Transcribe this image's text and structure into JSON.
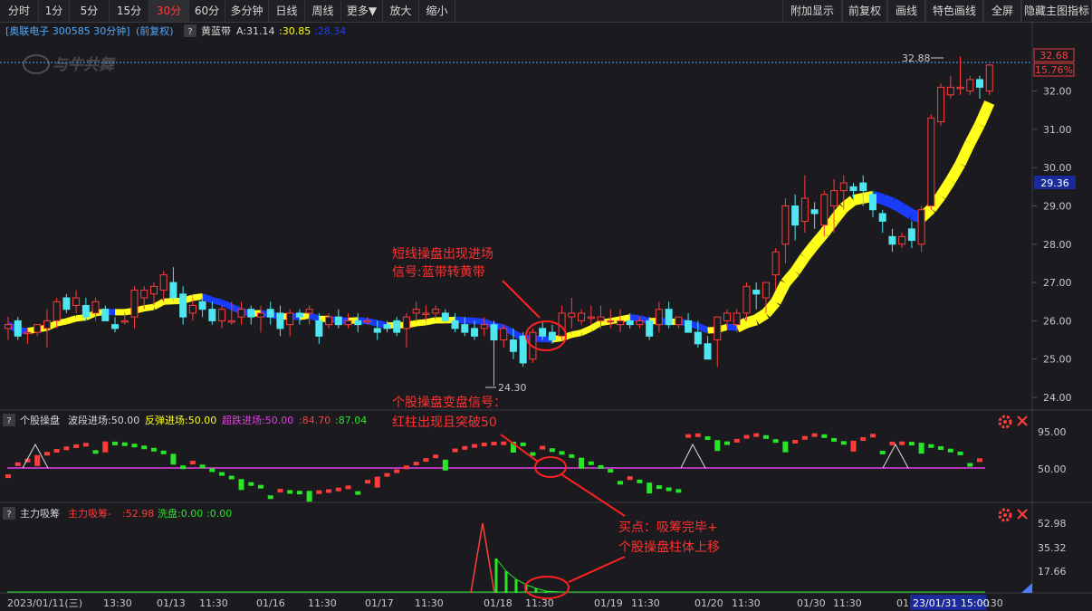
{
  "toolbar": {
    "left": [
      {
        "label": "分时",
        "active": false
      },
      {
        "label": "1分",
        "active": false
      },
      {
        "label": "5分",
        "active": false
      },
      {
        "label": "15分",
        "active": false
      },
      {
        "label": "30分",
        "active": true
      },
      {
        "label": "60分",
        "active": false
      },
      {
        "label": "多分钟",
        "active": false
      },
      {
        "label": "日线",
        "active": false
      },
      {
        "label": "周线",
        "active": false
      },
      {
        "label": "更多▼",
        "active": false
      },
      {
        "label": "放大",
        "active": false
      },
      {
        "label": "缩小",
        "active": false
      }
    ],
    "right": [
      {
        "label": "附加显示"
      },
      {
        "label": "前复权"
      },
      {
        "label": "画线"
      },
      {
        "label": "特色画线"
      },
      {
        "label": "全屏"
      },
      {
        "label": "隐藏主图指标"
      }
    ]
  },
  "main": {
    "stock_label": "[奥联电子 300585 30分钟]",
    "adjust_label": "(前复权)",
    "help_mark": "?",
    "indicator_name": "黄蓝带",
    "ind_a": "A:31.14",
    "ind_b": ":30.85",
    "ind_c": ":28.34",
    "watermark": "与牛共舞",
    "high_label": "32.88",
    "low_label": "24.30",
    "last_price": "32.68",
    "pct_change": "15.76%",
    "band_price": "29.36",
    "y_ticks": [
      "32.00",
      "31.00",
      "30.00",
      "29.00",
      "28.00",
      "27.00",
      "26.00",
      "25.00",
      "24.00"
    ],
    "annotation_line1": "短线操盘出现进场",
    "annotation_line2": "信号:蓝带转黄带"
  },
  "panel1": {
    "help_mark": "?",
    "name": "个股操盘",
    "a": "波段进场:50.00",
    "b": "反弹进场:50.00",
    "c": "超跌进场:50.00",
    "d": ":84.70",
    "e": ":87.04",
    "y_ticks": [
      "95.00",
      "50.00"
    ],
    "annotation_line1": "个股操盘变盘信号：",
    "annotation_line2": "红柱出现且突破50"
  },
  "panel2": {
    "help_mark": "?",
    "name": "主力吸筹",
    "a": "主力吸筹-",
    "b": ":52.98",
    "c": "洗盘:0.00",
    "d": ":0.00",
    "y_ticks": [
      "52.98",
      "35.32",
      "17.66"
    ],
    "annotation_line1": "买点：吸筹完毕+",
    "annotation_line2": "个股操盘柱体上移"
  },
  "xaxis": {
    "labels": [
      "2023/01/11(三)",
      "13:30",
      "01/13",
      "11:30",
      "01/16",
      "11:30",
      "01/17",
      "11:30",
      "01/18",
      "11:30",
      "01/19",
      "11:30",
      "01/20",
      "11:30",
      "01/30",
      "11:30",
      "01"
    ],
    "cursor_label": "23/01/31 15:00",
    "tail_label": ":30"
  },
  "colors": {
    "up": "#ff3c3c",
    "down": "#4fe6f0",
    "yellow": "#ffff1a",
    "blue": "#1a3cff",
    "green": "#27e627",
    "magenta": "#e63ce6",
    "accent_red": "#ff2020"
  },
  "chart_data": {
    "type": "candlestick",
    "candles": [
      [
        25.8,
        26.1,
        25.5,
        25.9
      ],
      [
        26.0,
        26.1,
        25.5,
        25.6
      ],
      [
        25.7,
        25.8,
        25.4,
        25.7
      ],
      [
        25.7,
        25.9,
        25.6,
        25.9
      ],
      [
        25.8,
        26.3,
        25.3,
        26.0
      ],
      [
        26.0,
        26.6,
        25.8,
        26.5
      ],
      [
        26.6,
        26.7,
        26.2,
        26.3
      ],
      [
        26.4,
        26.8,
        26.2,
        26.6
      ],
      [
        26.4,
        26.6,
        26.0,
        26.1
      ],
      [
        26.2,
        26.6,
        26.0,
        26.5
      ],
      [
        26.3,
        26.4,
        26.0,
        26.0
      ],
      [
        25.9,
        26.1,
        25.7,
        25.8
      ],
      [
        26.0,
        26.2,
        25.9,
        26.0
      ],
      [
        26.1,
        26.9,
        25.8,
        26.8
      ],
      [
        26.6,
        26.9,
        26.3,
        26.8
      ],
      [
        26.7,
        27.0,
        26.4,
        26.9
      ],
      [
        26.8,
        27.3,
        26.5,
        27.2
      ],
      [
        27.0,
        27.4,
        26.5,
        26.6
      ],
      [
        26.7,
        26.9,
        25.9,
        26.1
      ],
      [
        26.2,
        26.6,
        26.0,
        26.4
      ],
      [
        26.5,
        26.7,
        26.1,
        26.3
      ],
      [
        26.3,
        26.5,
        25.9,
        26.0
      ],
      [
        26.0,
        26.4,
        25.8,
        26.3
      ],
      [
        26.0,
        26.5,
        25.9,
        26.0
      ],
      [
        26.1,
        26.5,
        25.9,
        26.3
      ],
      [
        26.3,
        26.4,
        25.9,
        26.1
      ],
      [
        26.1,
        26.4,
        25.7,
        26.2
      ],
      [
        26.3,
        26.5,
        25.9,
        26.1
      ],
      [
        26.2,
        26.4,
        25.6,
        25.8
      ],
      [
        25.9,
        26.3,
        25.6,
        26.2
      ],
      [
        26.2,
        26.3,
        25.9,
        26.1
      ],
      [
        26.2,
        26.4,
        25.9,
        26.3
      ],
      [
        26.0,
        26.2,
        25.4,
        25.6
      ],
      [
        25.9,
        26.2,
        25.8,
        26.1
      ],
      [
        26.1,
        26.3,
        25.8,
        25.9
      ],
      [
        25.9,
        26.2,
        25.8,
        26.0
      ],
      [
        26.0,
        26.2,
        25.7,
        25.9
      ],
      [
        26.0,
        26.1,
        25.9,
        26.0
      ],
      [
        25.8,
        26.0,
        25.5,
        25.7
      ],
      [
        25.9,
        26.0,
        25.7,
        25.8
      ],
      [
        26.0,
        26.1,
        25.6,
        25.7
      ],
      [
        25.8,
        26.2,
        25.3,
        26.1
      ],
      [
        26.2,
        26.5,
        26.0,
        26.3
      ],
      [
        26.2,
        26.4,
        26.0,
        26.2
      ],
      [
        26.2,
        26.4,
        26.1,
        26.3
      ],
      [
        26.2,
        26.3,
        26.0,
        26.0
      ],
      [
        26.0,
        26.2,
        25.7,
        25.8
      ],
      [
        25.9,
        26.1,
        25.6,
        25.7
      ],
      [
        25.8,
        26.0,
        25.5,
        25.6
      ],
      [
        25.8,
        26.1,
        25.6,
        25.9
      ],
      [
        25.9,
        26.0,
        24.3,
        25.5
      ],
      [
        25.5,
        25.9,
        25.3,
        25.8
      ],
      [
        25.5,
        25.8,
        25.0,
        25.2
      ],
      [
        25.6,
        25.7,
        24.8,
        24.9
      ],
      [
        25.0,
        25.8,
        24.9,
        25.7
      ],
      [
        25.8,
        26.0,
        25.5,
        25.6
      ],
      [
        25.7,
        25.9,
        25.4,
        25.5
      ],
      [
        25.6,
        26.4,
        25.5,
        26.2
      ],
      [
        26.1,
        26.6,
        25.8,
        26.2
      ],
      [
        26.0,
        26.3,
        25.9,
        26.2
      ],
      [
        26.1,
        26.4,
        25.9,
        26.1
      ],
      [
        26.0,
        26.4,
        25.8,
        26.1
      ],
      [
        26.0,
        26.3,
        25.8,
        26.0
      ],
      [
        25.9,
        26.3,
        25.7,
        26.0
      ],
      [
        26.0,
        26.2,
        25.8,
        25.9
      ],
      [
        25.9,
        26.1,
        25.8,
        26.0
      ],
      [
        26.0,
        26.1,
        25.5,
        25.6
      ],
      [
        25.9,
        26.5,
        25.7,
        26.3
      ],
      [
        26.3,
        26.5,
        25.8,
        25.9
      ],
      [
        25.9,
        26.1,
        25.8,
        26.1
      ],
      [
        26.0,
        26.2,
        25.7,
        25.7
      ],
      [
        25.7,
        26.0,
        25.3,
        25.4
      ],
      [
        25.4,
        25.6,
        25.0,
        25.0
      ],
      [
        25.5,
        26.1,
        24.8,
        26.1
      ],
      [
        26.0,
        26.3,
        25.8,
        26.2
      ],
      [
        25.9,
        26.3,
        25.7,
        26.2
      ],
      [
        26.2,
        27.0,
        26.0,
        26.9
      ],
      [
        26.8,
        27.0,
        26.3,
        26.7
      ],
      [
        26.6,
        27.0,
        26.2,
        27.0
      ],
      [
        27.2,
        27.9,
        26.8,
        27.8
      ],
      [
        28.0,
        29.2,
        27.5,
        29.0
      ],
      [
        29.0,
        29.3,
        28.1,
        28.5
      ],
      [
        28.6,
        29.8,
        28.3,
        29.2
      ],
      [
        28.9,
        29.1,
        28.4,
        28.8
      ],
      [
        28.5,
        29.4,
        28.2,
        29.3
      ],
      [
        29.0,
        29.7,
        28.3,
        29.4
      ],
      [
        29.4,
        29.8,
        28.9,
        29.6
      ],
      [
        29.5,
        29.6,
        29.2,
        29.4
      ],
      [
        29.6,
        29.8,
        29.0,
        29.4
      ],
      [
        29.3,
        29.4,
        28.7,
        28.9
      ],
      [
        28.8,
        28.9,
        28.3,
        28.6
      ],
      [
        28.2,
        28.4,
        27.8,
        28.0
      ],
      [
        28.0,
        28.3,
        27.9,
        28.2
      ],
      [
        28.4,
        28.6,
        27.9,
        28.1
      ],
      [
        28.0,
        29.0,
        27.8,
        28.9
      ],
      [
        29.0,
        31.4,
        28.9,
        31.3
      ],
      [
        31.2,
        32.2,
        31.1,
        32.1
      ],
      [
        31.9,
        32.4,
        31.8,
        32.1
      ],
      [
        32.1,
        32.9,
        31.9,
        32.1
      ],
      [
        32.0,
        32.4,
        31.9,
        32.3
      ],
      [
        32.3,
        32.4,
        31.8,
        32.1
      ],
      [
        32.0,
        32.7,
        31.9,
        32.68
      ]
    ]
  }
}
